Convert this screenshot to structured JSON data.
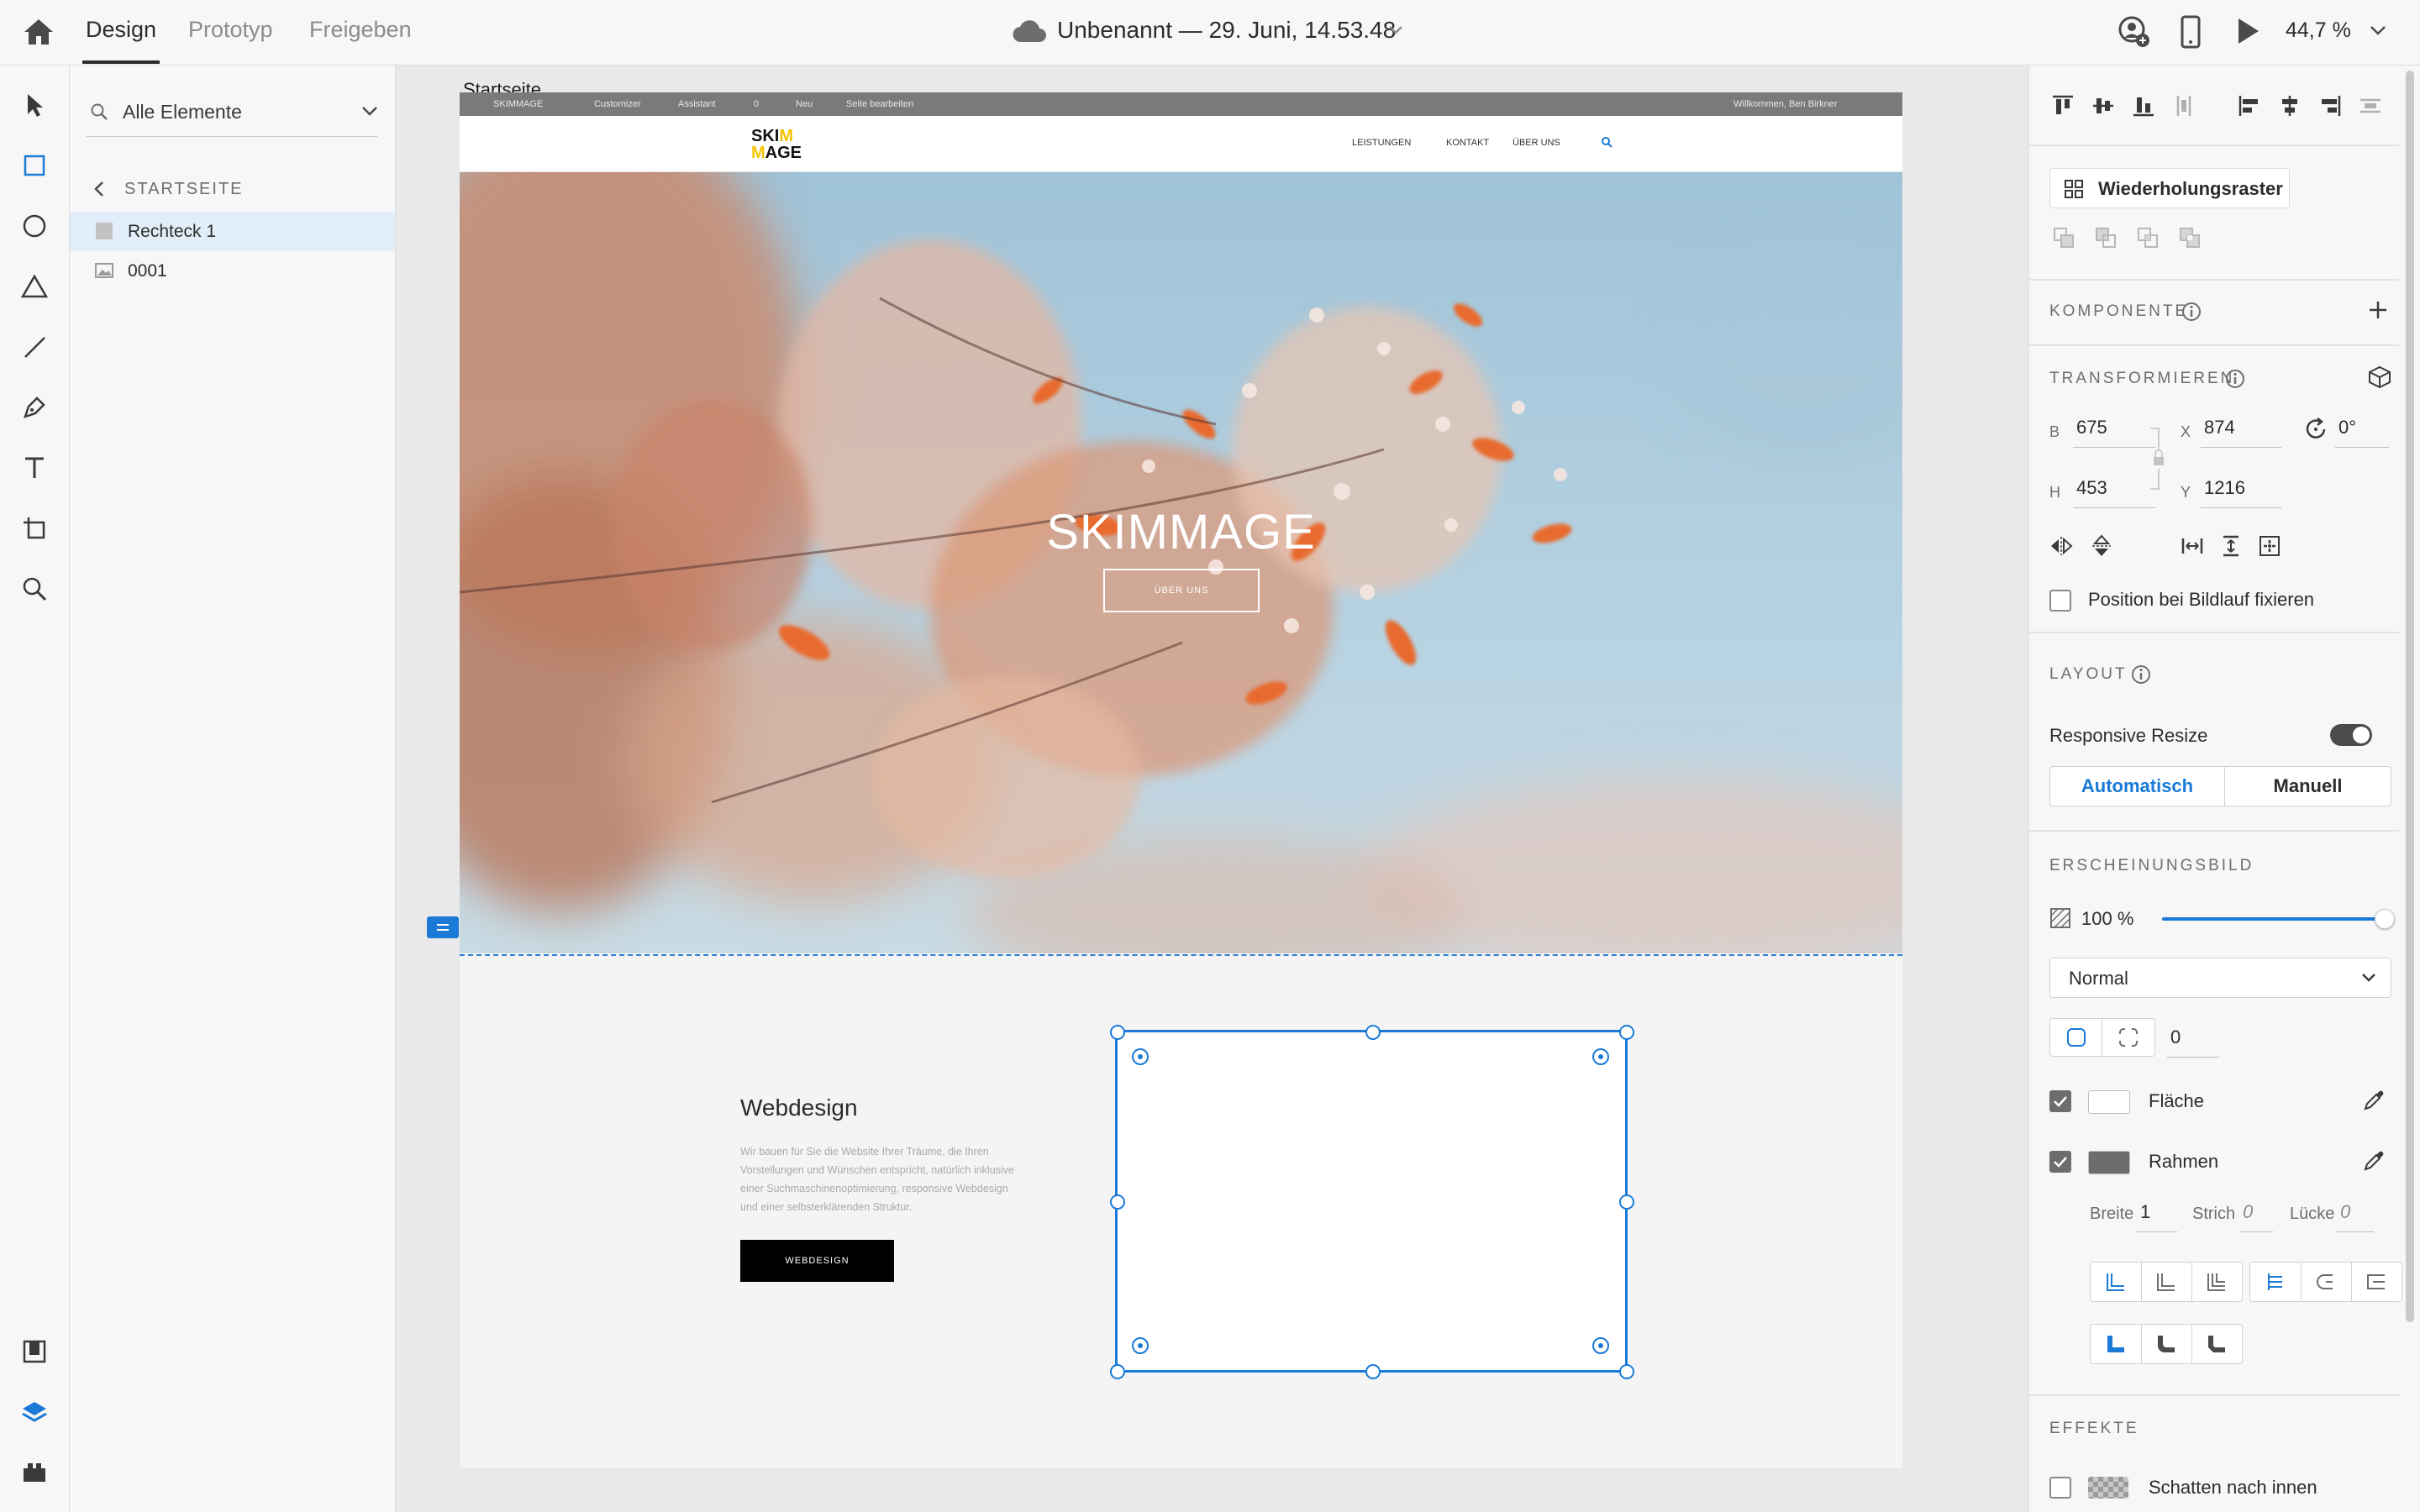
{
  "topbar": {
    "tabs": [
      "Design",
      "Prototyp",
      "Freigeben"
    ],
    "active_tab": "Design",
    "doc_title": "Unbenannt — 29. Juni, 14.53.48",
    "zoom": "44,7 %"
  },
  "layers": {
    "search_placeholder": "Alle Elemente",
    "section": "STARTSEITE",
    "items": [
      {
        "label": "Rechteck 1",
        "selected": true,
        "icon": "rectangle-icon"
      },
      {
        "label": "0001",
        "selected": false,
        "icon": "image-icon"
      }
    ]
  },
  "canvas": {
    "artboard_name": "Startseite",
    "wp_admin_bar": {
      "items": [
        "SKIMMAGE",
        "Customizer",
        "Assistant",
        "0",
        "Neu",
        "Seite bearbeiten"
      ],
      "greeting": "Willkommen, Ben Birkner"
    },
    "site": {
      "logo_top": "SKI",
      "logo_accent": "M",
      "logo_bottom": "AGE",
      "nav": [
        "LEISTUNGEN",
        "KONTAKT",
        "ÜBER UNS"
      ],
      "hero_title": "SKIMMAGE",
      "hero_button": "ÜBER UNS",
      "section_title": "Webdesign",
      "section_text": "Wir bauen für Sie die Website Ihrer Träume, die Ihren Vorstellungen und Wünschen entspricht, natürlich inklusive einer Suchmaschinenoptimierung, responsive Webdesign und einer selbsterklärenden Struktur.",
      "section_button": "WEBDESIGN"
    },
    "accent_color": "#1a7ad6",
    "logo_accent_color": "#f2c500"
  },
  "properties": {
    "repeat_grid_label": "Wiederholungsraster",
    "component_title": "KOMPONENTE",
    "transform_title": "TRANSFORMIEREN",
    "width_label": "B",
    "width_value": "675",
    "height_label": "H",
    "height_value": "453",
    "x_label": "X",
    "x_value": "874",
    "y_label": "Y",
    "y_value": "1216",
    "rotation_value": "0°",
    "fix_position_label": "Position bei Bildlauf fixieren",
    "layout_title": "LAYOUT",
    "responsive_resize_label": "Responsive Resize",
    "responsive_resize_on": true,
    "resize_modes": [
      "Automatisch",
      "Manuell"
    ],
    "appearance_title": "ERSCHEINUNGSBILD",
    "opacity_value": "100 %",
    "opacity_fraction": 1.0,
    "blend_mode": "Normal",
    "corner_radius": "0",
    "fill_label": "Fläche",
    "fill_checked": true,
    "fill_color": "#ffffff",
    "border_label": "Rahmen",
    "border_checked": true,
    "border_color": "#6d6d6d",
    "stroke_width_label": "Breite",
    "stroke_width_value": "1",
    "dash_label": "Strich",
    "dash_value": "0",
    "gap_label": "Lücke",
    "gap_value": "0",
    "effects_title": "EFFEKTE",
    "inner_shadow_label": "Schatten nach innen",
    "inner_shadow_checked": false
  }
}
